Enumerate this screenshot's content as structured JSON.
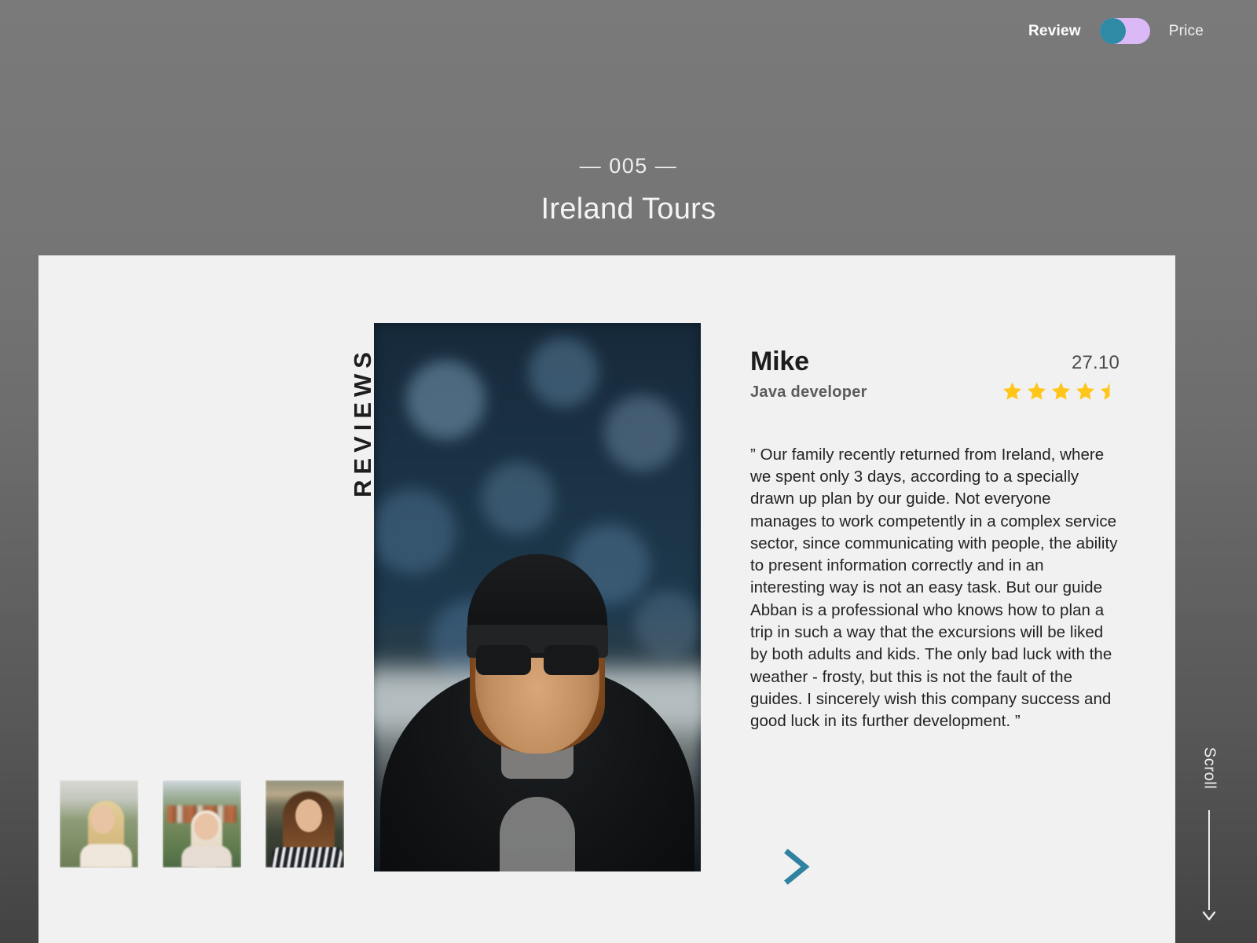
{
  "topbar": {
    "left_label": "Review",
    "right_label": "Price",
    "toggle_state": "left",
    "toggle_knob_color": "#2f8aa6",
    "toggle_track_color": "#dbb9f7"
  },
  "heading": {
    "index": "— 005 —",
    "title": "Ireland Tours"
  },
  "panel": {
    "section_label": "REVIEWS",
    "hero_photo_alt": "man-in-beanie-and-sunglasses-portrait"
  },
  "review": {
    "name": "Mike",
    "role": "Java developer",
    "date": "27.10",
    "rating": 4.5,
    "rating_max": 5,
    "star_color": "#ffc61a",
    "text": "” Our family recently returned from Ireland, where we spent only 3 days, according to a specially drawn up plan by our guide. Not everyone manages to work competently in a complex service sector, since communicating with people, the ability to present information correctly and in an interesting way is not an easy task. But our guide Abban is a professional who knows how to plan a trip in such a way that the excursions will be liked by both adults and kids. The only bad luck with the weather - frosty, but this is not the fault of the guides. I sincerely wish this company success and good luck in its further development. ”",
    "next_arrow_color": "#2f82a0"
  },
  "thumbnails": [
    {
      "alt": "blonde-woman-in-field-portrait"
    },
    {
      "alt": "laughing-woman-with-glasses-portrait"
    },
    {
      "alt": "brunette-woman-striped-shirt-portrait"
    }
  ],
  "scroll": {
    "label": "Scroll"
  },
  "colors": {
    "background_top": "#757575",
    "background_bottom": "#434343",
    "panel": "#f1f1f1",
    "accent_teal": "#2f8aa6",
    "accent_purple": "#dbb9f7",
    "star_yellow": "#ffc61a"
  }
}
